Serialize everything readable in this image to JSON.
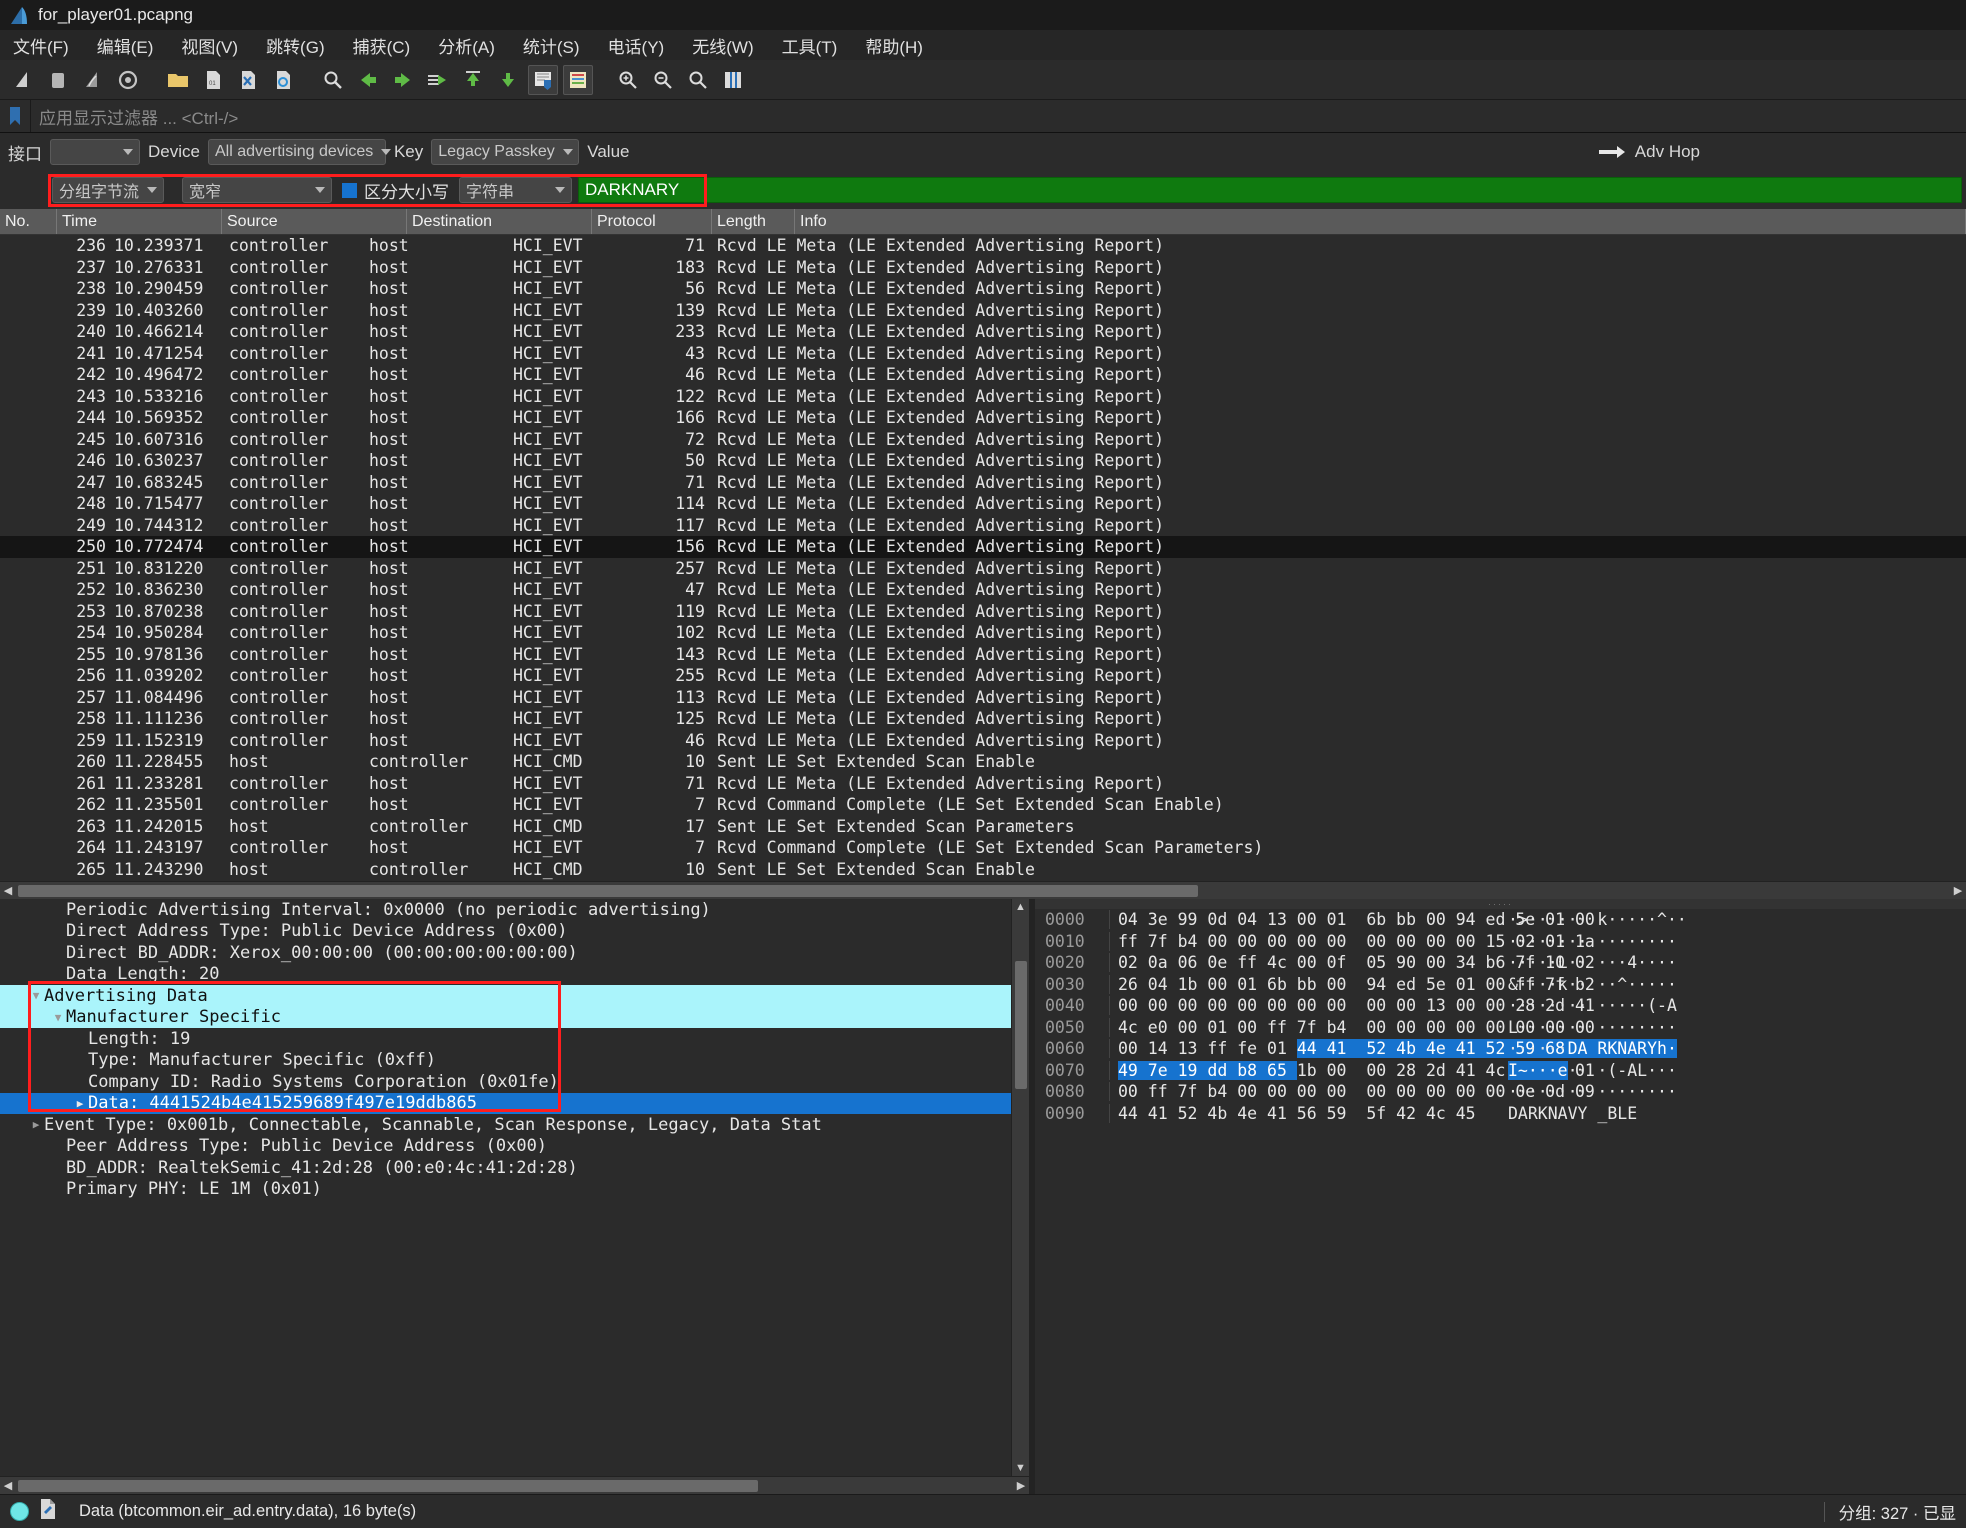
{
  "window": {
    "title": "for_player01.pcapng",
    "app_icon": "wireshark-fin-icon"
  },
  "menubar": {
    "items": [
      {
        "label": "文件(F)",
        "name": "menu-file"
      },
      {
        "label": "编辑(E)",
        "name": "menu-edit"
      },
      {
        "label": "视图(V)",
        "name": "menu-view"
      },
      {
        "label": "跳转(G)",
        "name": "menu-go"
      },
      {
        "label": "捕获(C)",
        "name": "menu-capture"
      },
      {
        "label": "分析(A)",
        "name": "menu-analyze"
      },
      {
        "label": "统计(S)",
        "name": "menu-statistics"
      },
      {
        "label": "电话(Y)",
        "name": "menu-telephony"
      },
      {
        "label": "无线(W)",
        "name": "menu-wireless"
      },
      {
        "label": "工具(T)",
        "name": "menu-tools"
      },
      {
        "label": "帮助(H)",
        "name": "menu-help"
      }
    ]
  },
  "toolbar": {
    "buttons": [
      "start-capture-icon",
      "stop-capture-icon",
      "restart-capture-icon",
      "capture-options-icon",
      "open-file-icon",
      "save-file-icon",
      "close-file-icon",
      "reload-file-icon",
      "find-packet-icon",
      "go-back-icon",
      "go-forward-icon",
      "go-to-packet-icon",
      "go-first-packet-icon",
      "go-last-packet-icon",
      "autoscroll-icon",
      "colorize-icon",
      "zoom-in-icon",
      "zoom-out-icon",
      "zoom-reset-icon",
      "resize-columns-icon"
    ]
  },
  "display_filter": {
    "icon": "bookmark-icon",
    "placeholder": "应用显示过滤器 ... <Ctrl-/>",
    "value": ""
  },
  "bluetooth_bar": {
    "interface_label": "接口",
    "interface_value": "",
    "device_label": "Device",
    "device_value": "All advertising devices",
    "key_label": "Key",
    "key_value": "Legacy Passkey",
    "value_label": "Value",
    "value_value": "",
    "adv_hop_label": "Adv Hop",
    "adv_hop_icon": "arrow-right-icon"
  },
  "find_bar": {
    "search_in_value": "分组字节流",
    "width_value": "宽窄",
    "case_sensitive_label": "区分大小写",
    "case_sensitive_checked": true,
    "type_value": "字符串",
    "search_value": "DARKNARY",
    "highlight_color": "#ff1d1d",
    "field_bg": "#0f7a0f"
  },
  "packet_list": {
    "columns": [
      {
        "label": "No.",
        "name": "col-no"
      },
      {
        "label": "Time",
        "name": "col-time"
      },
      {
        "label": "Source",
        "name": "col-source"
      },
      {
        "label": "Destination",
        "name": "col-destination"
      },
      {
        "label": "Protocol",
        "name": "col-protocol"
      },
      {
        "label": "Length",
        "name": "col-length"
      },
      {
        "label": "Info",
        "name": "col-info"
      }
    ],
    "rows": [
      {
        "no": "236",
        "time": "10.239371",
        "src": "controller",
        "dst": "host",
        "proto": "HCI_EVT",
        "len": "71",
        "info": "Rcvd LE Meta (LE Extended Advertising Report)"
      },
      {
        "no": "237",
        "time": "10.276331",
        "src": "controller",
        "dst": "host",
        "proto": "HCI_EVT",
        "len": "183",
        "info": "Rcvd LE Meta (LE Extended Advertising Report)"
      },
      {
        "no": "238",
        "time": "10.290459",
        "src": "controller",
        "dst": "host",
        "proto": "HCI_EVT",
        "len": "56",
        "info": "Rcvd LE Meta (LE Extended Advertising Report)"
      },
      {
        "no": "239",
        "time": "10.403260",
        "src": "controller",
        "dst": "host",
        "proto": "HCI_EVT",
        "len": "139",
        "info": "Rcvd LE Meta (LE Extended Advertising Report)"
      },
      {
        "no": "240",
        "time": "10.466214",
        "src": "controller",
        "dst": "host",
        "proto": "HCI_EVT",
        "len": "233",
        "info": "Rcvd LE Meta (LE Extended Advertising Report)"
      },
      {
        "no": "241",
        "time": "10.471254",
        "src": "controller",
        "dst": "host",
        "proto": "HCI_EVT",
        "len": "43",
        "info": "Rcvd LE Meta (LE Extended Advertising Report)"
      },
      {
        "no": "242",
        "time": "10.496472",
        "src": "controller",
        "dst": "host",
        "proto": "HCI_EVT",
        "len": "46",
        "info": "Rcvd LE Meta (LE Extended Advertising Report)"
      },
      {
        "no": "243",
        "time": "10.533216",
        "src": "controller",
        "dst": "host",
        "proto": "HCI_EVT",
        "len": "122",
        "info": "Rcvd LE Meta (LE Extended Advertising Report)"
      },
      {
        "no": "244",
        "time": "10.569352",
        "src": "controller",
        "dst": "host",
        "proto": "HCI_EVT",
        "len": "166",
        "info": "Rcvd LE Meta (LE Extended Advertising Report)"
      },
      {
        "no": "245",
        "time": "10.607316",
        "src": "controller",
        "dst": "host",
        "proto": "HCI_EVT",
        "len": "72",
        "info": "Rcvd LE Meta (LE Extended Advertising Report)"
      },
      {
        "no": "246",
        "time": "10.630237",
        "src": "controller",
        "dst": "host",
        "proto": "HCI_EVT",
        "len": "50",
        "info": "Rcvd LE Meta (LE Extended Advertising Report)"
      },
      {
        "no": "247",
        "time": "10.683245",
        "src": "controller",
        "dst": "host",
        "proto": "HCI_EVT",
        "len": "71",
        "info": "Rcvd LE Meta (LE Extended Advertising Report)"
      },
      {
        "no": "248",
        "time": "10.715477",
        "src": "controller",
        "dst": "host",
        "proto": "HCI_EVT",
        "len": "114",
        "info": "Rcvd LE Meta (LE Extended Advertising Report)"
      },
      {
        "no": "249",
        "time": "10.744312",
        "src": "controller",
        "dst": "host",
        "proto": "HCI_EVT",
        "len": "117",
        "info": "Rcvd LE Meta (LE Extended Advertising Report)"
      },
      {
        "no": "250",
        "time": "10.772474",
        "src": "controller",
        "dst": "host",
        "proto": "HCI_EVT",
        "len": "156",
        "info": "Rcvd LE Meta (LE Extended Advertising Report)"
      },
      {
        "no": "251",
        "time": "10.831220",
        "src": "controller",
        "dst": "host",
        "proto": "HCI_EVT",
        "len": "257",
        "info": "Rcvd LE Meta (LE Extended Advertising Report)"
      },
      {
        "no": "252",
        "time": "10.836230",
        "src": "controller",
        "dst": "host",
        "proto": "HCI_EVT",
        "len": "47",
        "info": "Rcvd LE Meta (LE Extended Advertising Report)"
      },
      {
        "no": "253",
        "time": "10.870238",
        "src": "controller",
        "dst": "host",
        "proto": "HCI_EVT",
        "len": "119",
        "info": "Rcvd LE Meta (LE Extended Advertising Report)"
      },
      {
        "no": "254",
        "time": "10.950284",
        "src": "controller",
        "dst": "host",
        "proto": "HCI_EVT",
        "len": "102",
        "info": "Rcvd LE Meta (LE Extended Advertising Report)"
      },
      {
        "no": "255",
        "time": "10.978136",
        "src": "controller",
        "dst": "host",
        "proto": "HCI_EVT",
        "len": "143",
        "info": "Rcvd LE Meta (LE Extended Advertising Report)"
      },
      {
        "no": "256",
        "time": "11.039202",
        "src": "controller",
        "dst": "host",
        "proto": "HCI_EVT",
        "len": "255",
        "info": "Rcvd LE Meta (LE Extended Advertising Report)"
      },
      {
        "no": "257",
        "time": "11.084496",
        "src": "controller",
        "dst": "host",
        "proto": "HCI_EVT",
        "len": "113",
        "info": "Rcvd LE Meta (LE Extended Advertising Report)"
      },
      {
        "no": "258",
        "time": "11.111236",
        "src": "controller",
        "dst": "host",
        "proto": "HCI_EVT",
        "len": "125",
        "info": "Rcvd LE Meta (LE Extended Advertising Report)"
      },
      {
        "no": "259",
        "time": "11.152319",
        "src": "controller",
        "dst": "host",
        "proto": "HCI_EVT",
        "len": "46",
        "info": "Rcvd LE Meta (LE Extended Advertising Report)"
      },
      {
        "no": "260",
        "time": "11.228455",
        "src": "host",
        "dst": "controller",
        "proto": "HCI_CMD",
        "len": "10",
        "info": "Sent LE Set Extended Scan Enable"
      },
      {
        "no": "261",
        "time": "11.233281",
        "src": "controller",
        "dst": "host",
        "proto": "HCI_EVT",
        "len": "71",
        "info": "Rcvd LE Meta (LE Extended Advertising Report)"
      },
      {
        "no": "262",
        "time": "11.235501",
        "src": "controller",
        "dst": "host",
        "proto": "HCI_EVT",
        "len": "7",
        "info": "Rcvd Command Complete (LE Set Extended Scan Enable)"
      },
      {
        "no": "263",
        "time": "11.242015",
        "src": "host",
        "dst": "controller",
        "proto": "HCI_CMD",
        "len": "17",
        "info": "Sent LE Set Extended Scan Parameters"
      },
      {
        "no": "264",
        "time": "11.243197",
        "src": "controller",
        "dst": "host",
        "proto": "HCI_EVT",
        "len": "7",
        "info": "Rcvd Command Complete (LE Set Extended Scan Parameters)"
      },
      {
        "no": "265",
        "time": "11.243290",
        "src": "host",
        "dst": "controller",
        "proto": "HCI_CMD",
        "len": "10",
        "info": "Sent LE Set Extended Scan Enable"
      }
    ]
  },
  "detail_tree": {
    "rows": [
      {
        "text": "Periodic Advertising Interval: 0x0000 (no periodic advertising)",
        "indent": 3,
        "twisty": "",
        "hl": ""
      },
      {
        "text": "Direct Address Type: Public Device Address (0x00)",
        "indent": 3,
        "twisty": "",
        "hl": ""
      },
      {
        "text": "Direct BD_ADDR: Xerox_00:00:00 (00:00:00:00:00:00)",
        "indent": 3,
        "twisty": "",
        "hl": ""
      },
      {
        "text": "Data Length: 20",
        "indent": 3,
        "twisty": "",
        "hl": ""
      },
      {
        "text": "Advertising Data",
        "indent": 2,
        "twisty": "▼",
        "hl": "cyan"
      },
      {
        "text": "Manufacturer Specific",
        "indent": 3,
        "twisty": "▼",
        "hl": "cyan"
      },
      {
        "text": "Length: 19",
        "indent": 4,
        "twisty": "",
        "hl": ""
      },
      {
        "text": "Type: Manufacturer Specific (0xff)",
        "indent": 4,
        "twisty": "",
        "hl": ""
      },
      {
        "text": "Company ID: Radio Systems Corporation (0x01fe)",
        "indent": 4,
        "twisty": "",
        "hl": ""
      },
      {
        "text": "Data: 4441524b4e415259689f497e19ddb865",
        "indent": 4,
        "twisty": "▶",
        "hl": "blue"
      },
      {
        "text": "Event Type: 0x001b, Connectable, Scannable, Scan Response, Legacy, Data Stat",
        "indent": 2,
        "twisty": "▶",
        "hl": ""
      },
      {
        "text": "Peer Address Type: Public Device Address (0x00)",
        "indent": 3,
        "twisty": "",
        "hl": ""
      },
      {
        "text": "BD_ADDR: RealtekSemic_41:2d:28 (00:e0:4c:41:2d:28)",
        "indent": 3,
        "twisty": "",
        "hl": ""
      },
      {
        "text": "Primary PHY: LE 1M (0x01)",
        "indent": 3,
        "twisty": "",
        "hl": ""
      }
    ],
    "highlight_box_color": "#ff1d1d"
  },
  "hex_dump": {
    "rows": [
      {
        "offset": "0000",
        "bytes_pre": "",
        "bytes_sel": "",
        "bytes": "04 3e 99 0d 04 13 00 01  6b bb 00 94 ed 5e 01 00",
        "ascii": "·>······ k·····^··",
        "ascii_sel": ""
      },
      {
        "offset": "0010",
        "bytes": "ff 7f b4 00 00 00 00 00  00 00 00 00 15 02 01 1a",
        "ascii": "········ ········"
      },
      {
        "offset": "0020",
        "bytes": "02 0a 06 0e ff 4c 00 0f  05 90 00 34 b6 7f 10 02",
        "ascii": "·····L·· ···4····"
      },
      {
        "offset": "0030",
        "bytes": "26 04 1b 00 01 6b bb 00  94 ed 5e 01 00 ff 7f b2",
        "ascii": "&····k·· ··^·····"
      },
      {
        "offset": "0040",
        "bytes": "00 00 00 00 00 00 00 00  00 00 13 00 00 28 2d 41",
        "ascii": "········ ·····(-A"
      },
      {
        "offset": "0050",
        "bytes": "4c e0 00 01 00 ff 7f b4  00 00 00 00 00 00 00 00",
        "ascii": "L······· ········"
      },
      {
        "offset": "0060",
        "bytes_pre": "00 14 13 ff fe 01 ",
        "bytes_sel": "44 41  52 4b 4e 41 52 59 68 9f",
        "ascii_pre": "······",
        "ascii_sel": "DA RKNARYh·"
      },
      {
        "offset": "0070",
        "bytes_sel": "49 7e 19 dd b8 65 ",
        "bytes_post": "1b 00  00 28 2d 41 4c e0 00 01",
        "ascii_sel": "I~···e",
        "ascii_post": "·· ·(-AL···"
      },
      {
        "offset": "0080",
        "bytes": "00 ff 7f b4 00 00 00 00  00 00 00 00 00 0e 0d 09",
        "ascii": "········ ········"
      },
      {
        "offset": "0090",
        "bytes": "44 41 52 4b 4e 41 56 59  5f 42 4c 45",
        "ascii": "DARKNAVY _BLE"
      }
    ],
    "selection_color": "#1673cf"
  },
  "status_bar": {
    "expert_icon": "expert-info-icon",
    "capture_file_icon": "capture-file-properties-icon",
    "field_info": "Data (btcommon.eir_ad.entry.data), 16 byte(s)",
    "packets_info": "分组: 327 · 已显"
  }
}
